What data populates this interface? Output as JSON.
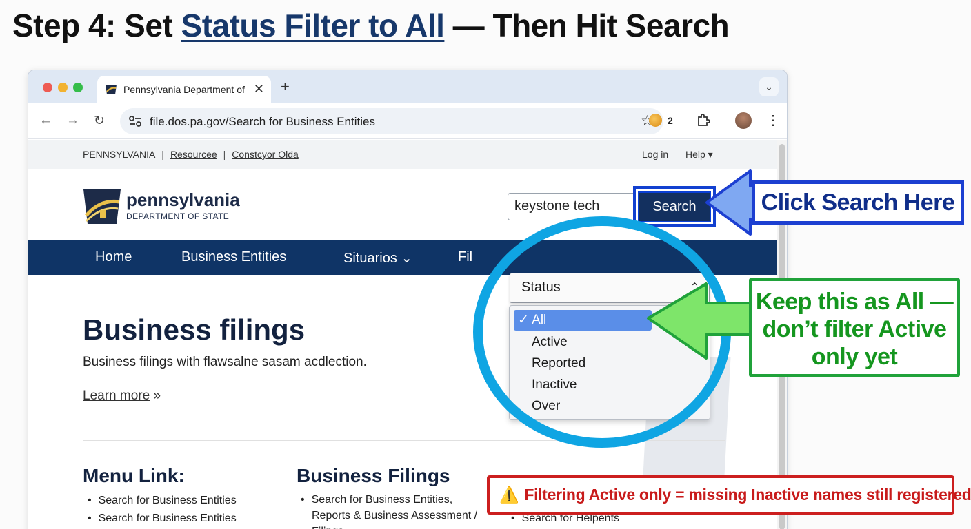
{
  "heading": {
    "prefix": "Step 4: Set ",
    "highlight": "Status Filter to All",
    "suffix": " — Then Hit Search"
  },
  "browser": {
    "tab_title": "Pennsylvania Department of State",
    "url": "file.dos.pa.gov/Search for Business Entities",
    "extension_count": "2"
  },
  "site": {
    "utility": {
      "state": "PENNSYLVANIA",
      "link1": "Resourcee",
      "link2": "Constcyor Olda",
      "login": "Log in",
      "help": "Help ▾"
    },
    "brand": {
      "name": "pennsylvania",
      "sub": "DEPARTMENT OF STATE"
    },
    "search": {
      "value": "keystone tech",
      "button": "Search"
    },
    "nav": {
      "home": "Home",
      "business": "Business Entities",
      "situarios": "Situarios ⌄",
      "partial": "Fil"
    },
    "status_filter": {
      "label": "Status",
      "selected": "✓ All",
      "options": [
        "Active",
        "Reported",
        "Inactive",
        "Over"
      ]
    },
    "hero": {
      "title": "Business filings",
      "lead": "Business filings with flawsalne sasam acdlection.",
      "learn_more": "Learn more",
      "learn_more_suffix": " »"
    },
    "col1": {
      "title": "Menu Link:",
      "items": [
        "Search for Business Entities",
        "Search for Business Entities"
      ]
    },
    "col2": {
      "title": "Business Filings",
      "items": [
        "Search for Business Entities, Reports & Business Assessment / Filings"
      ]
    },
    "col3": {
      "items": [
        "Search for Helpents"
      ]
    }
  },
  "callouts": {
    "blue": "Click Search Here",
    "green": [
      "Keep this as All —",
      "don’t filter Active",
      "only yet"
    ],
    "red": "Filtering Active only = missing Inactive names still registered",
    "red_icon": "warning-icon"
  },
  "colors": {
    "nav_bg": "#0f3466",
    "ring": "#0fa5e3",
    "blue_callout": "#1c3fd1",
    "green_callout": "#20a23a",
    "red_callout": "#cc1f1f"
  }
}
